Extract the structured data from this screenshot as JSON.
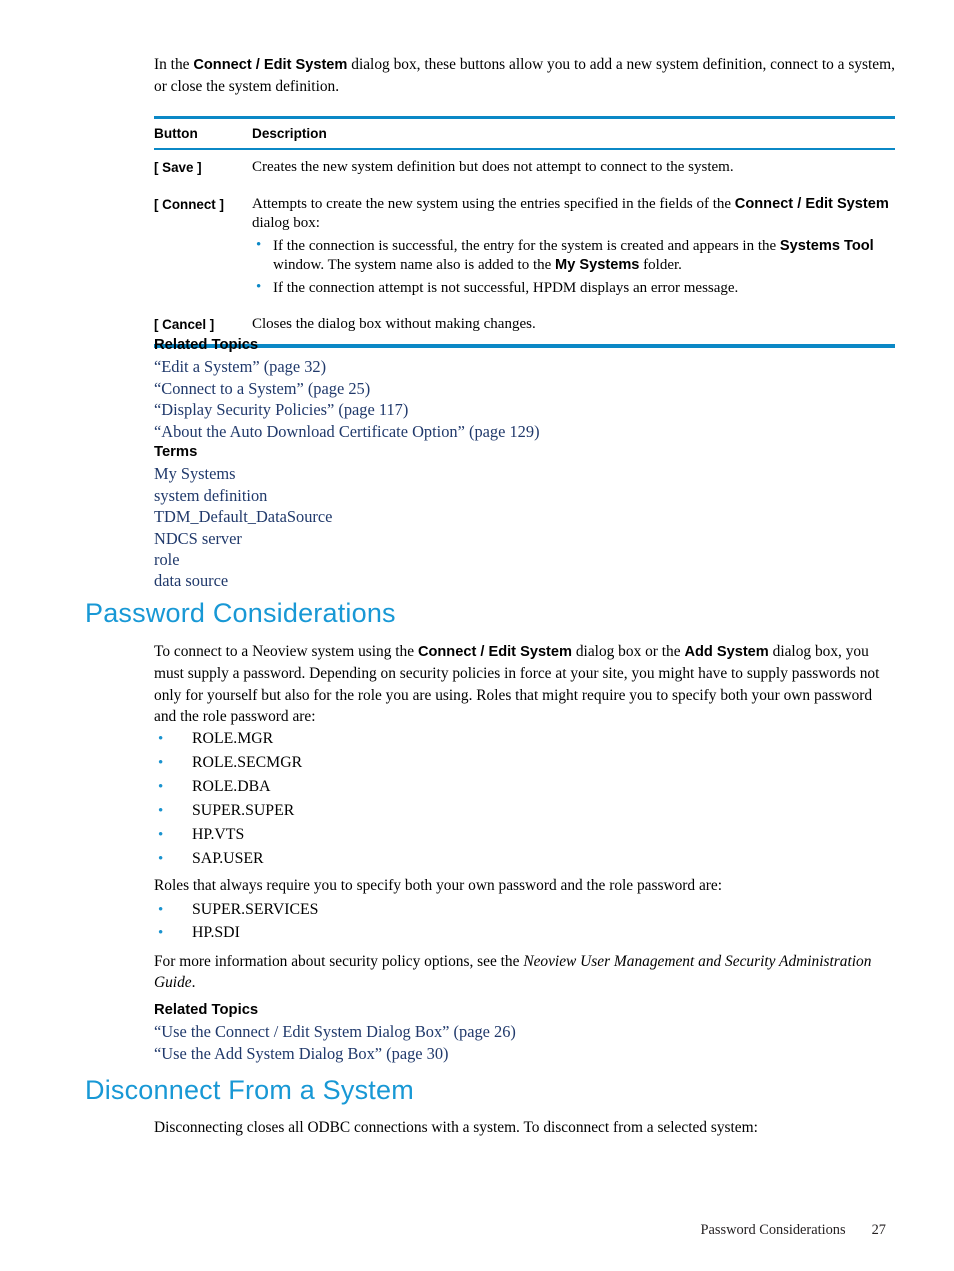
{
  "intro": {
    "text_before": "In the ",
    "bold_1": "Connect / Edit System",
    "text_after": " dialog box, these buttons allow you to add a new system definition, connect to a system, or close the system definition."
  },
  "button_table": {
    "headers": {
      "col1": "Button",
      "col2": "Description"
    },
    "rows": [
      {
        "button": "[ Save ]",
        "description": "Creates the new system definition but does not attempt to connect to the system.",
        "bullets": []
      },
      {
        "button": "[ Connect ]",
        "desc_part1": "Attempts to create the new system using the entries specified in the fields of the ",
        "desc_bold1": "Connect / Edit System",
        "desc_part2": " dialog box:",
        "bullets": [
          {
            "part1": "If the connection is successful, the entry for the system is created and appears in the ",
            "bold1": "Systems Tool",
            "part2": " window. The system name also is added to the ",
            "bold2": "My Systems",
            "part3": " folder."
          },
          {
            "part1": "If the connection attempt is not successful, HPDM displays an error message.",
            "bold1": "",
            "part2": "",
            "bold2": "",
            "part3": ""
          }
        ]
      },
      {
        "button": "[ Cancel ]",
        "description": "Closes the dialog box without making changes.",
        "bullets": []
      }
    ]
  },
  "related_topics_1": {
    "heading": "Related Topics",
    "links": [
      "“Edit a System” (page 32)",
      "“Connect to a System” (page 25)",
      "“Display Security Policies” (page 117)",
      "“About the Auto Download Certificate Option” (page 129)"
    ],
    "terms_heading": "Terms",
    "terms": [
      "My Systems",
      "system definition",
      "TDM_Default_DataSource",
      "NDCS server",
      "role",
      "data source"
    ]
  },
  "password_section": {
    "heading": "Password Considerations",
    "intro_part1": "To connect to a Neoview system using the ",
    "intro_bold1": "Connect / Edit System",
    "intro_part2": " dialog box or the ",
    "intro_bold2": "Add System",
    "intro_part3": " dialog box, you must supply a password. Depending on security policies in force at your site, you might have to supply passwords not only for yourself but also for the role you are using. Roles that might require you to specify both your own password and the role password are:",
    "roles_maybe": [
      "ROLE.MGR",
      "ROLE.SECMGR",
      "ROLE.DBA",
      "SUPER.SUPER",
      "HP.VTS",
      "SAP.USER"
    ],
    "always_intro": "Roles that always require you to specify both your own password and the role password are:",
    "roles_always": [
      "SUPER.SERVICES",
      "HP.SDI"
    ],
    "more_info_part1": "For more information about security policy options, see the ",
    "more_info_italic": "Neoview User Management and Security Administration Guide",
    "more_info_part2": "."
  },
  "related_topics_2": {
    "heading": "Related Topics",
    "links": [
      "“Use the Connect / Edit System Dialog Box” (page 26)",
      "“Use the Add System Dialog Box” (page 30)"
    ]
  },
  "disconnect_section": {
    "heading": "Disconnect From a System",
    "paragraph": "Disconnecting closes all ODBC connections with a system. To disconnect from a selected system:"
  },
  "footer": {
    "section": "Password Considerations",
    "page": "27"
  },
  "colors": {
    "heading_blue": "#1898d5",
    "rule_blue": "#0b88c6",
    "bullet_blue": "#1a93cf",
    "link_navy": "#20396b"
  }
}
